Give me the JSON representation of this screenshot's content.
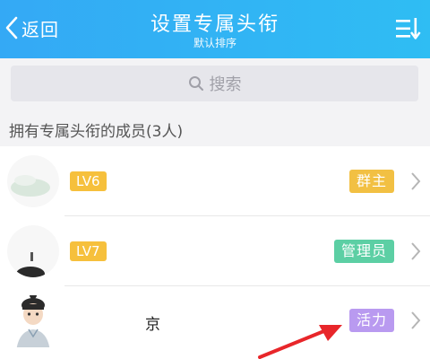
{
  "header": {
    "back_label": "返回",
    "title": "设置专属头衔",
    "subtitle": "默认排序",
    "sort_icon": "sort-icon"
  },
  "search": {
    "placeholder": "搜索",
    "icon": "search-icon"
  },
  "section": {
    "label": "拥有专属头衔的成员(3人)"
  },
  "members": [
    {
      "level": "LV6",
      "name": "",
      "title": "群主",
      "title_color": "#f2c043"
    },
    {
      "level": "LV7",
      "name": "",
      "title": "管理员",
      "title_color": "#5ccfa4"
    },
    {
      "level": "",
      "name": "京",
      "title": "活力",
      "title_color": "#b99af0"
    }
  ],
  "colors": {
    "header": "#34a9f5",
    "annotation_arrow": "#e8262a"
  }
}
